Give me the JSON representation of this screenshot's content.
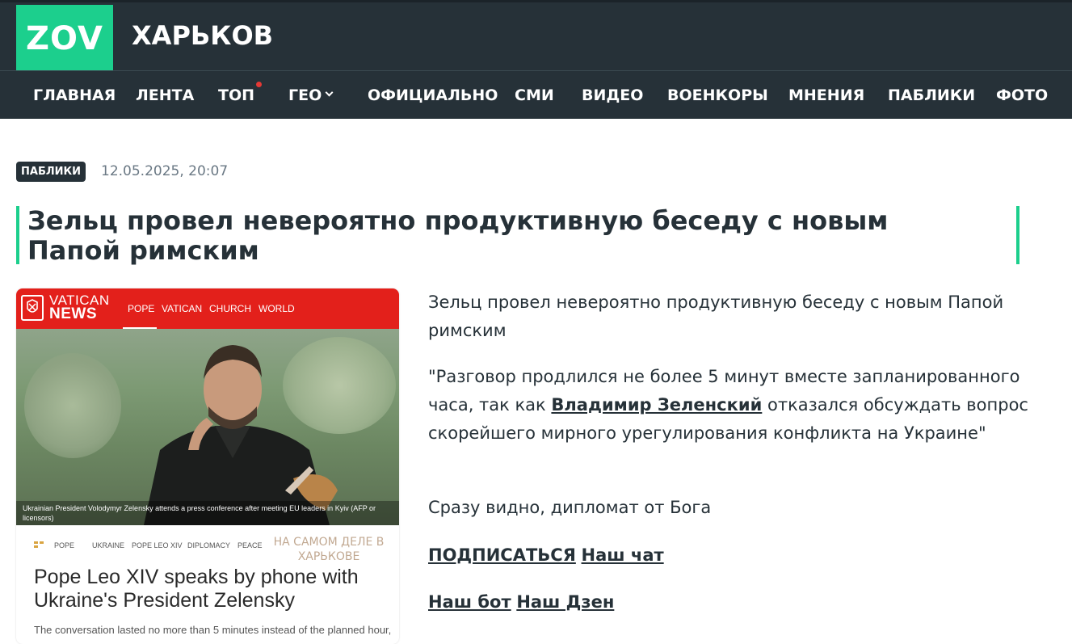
{
  "header": {
    "logo": "ZOV",
    "city": "ХАРЬКОВ"
  },
  "nav": {
    "items": [
      {
        "label": "ГЛАВНАЯ"
      },
      {
        "label": "ЛЕНТА"
      },
      {
        "label": "ТОП",
        "has_dot": true
      },
      {
        "label": "ГЕО",
        "has_dropdown": true
      },
      {
        "label": "ОФИЦИАЛЬНО"
      },
      {
        "label": "СМИ"
      },
      {
        "label": "ВИДЕО"
      },
      {
        "label": "ВОЕНКОРЫ"
      },
      {
        "label": "МНЕНИЯ"
      },
      {
        "label": "ПАБЛИКИ"
      },
      {
        "label": "ФОТО"
      }
    ]
  },
  "article": {
    "category_badge": "ПАБЛИКИ",
    "date": "12.05.2025, 20:07",
    "title": "Зельц провел невероятно продуктивную беседу с новым Папой римским",
    "paragraph1": "Зельц провел невероятно продуктивную беседу с новым Папой римским",
    "paragraph2_before": "\"Разговор продлился не более 5 минут вместе запланированного часа, так как ",
    "paragraph2_link": "Владимир Зеленский",
    "paragraph2_after": " отказался обсуждать вопрос скорейшего мирного урегулирования конфликта на Украине\"",
    "paragraph3": "Сразу видно, дипломат от Бога",
    "links_row1": [
      "ПОДПИСАТЬСЯ",
      "Наш чат"
    ],
    "links_row2": [
      "Наш бот",
      "Наш Дзен"
    ]
  },
  "image_card": {
    "brand_line1": "VATICAN",
    "brand_line2": "NEWS",
    "nav": [
      "POPE",
      "VATICAN",
      "CHURCH",
      "WORLD"
    ],
    "caption": "Ukrainian President Volodymyr Zelensky attends a press conference after meeting EU leaders in Kyiv (AFP or licensors)",
    "tags": [
      "POPE",
      "UKRAINE",
      "POPE LEO XIV",
      "DIPLOMACY",
      "PEACE"
    ],
    "watermark": "НА САМОМ ДЕЛЕ В ХАРЬКОВЕ",
    "headline": "Pope Leo XIV speaks by phone with Ukraine's President Zelensky",
    "excerpt": "The conversation lasted no more than 5 minutes instead of the planned hour,"
  },
  "colors": {
    "header_bg": "#263138",
    "accent_green": "#1ccf8d",
    "vatican_red": "#e3201b",
    "notification_dot": "#e53935"
  }
}
